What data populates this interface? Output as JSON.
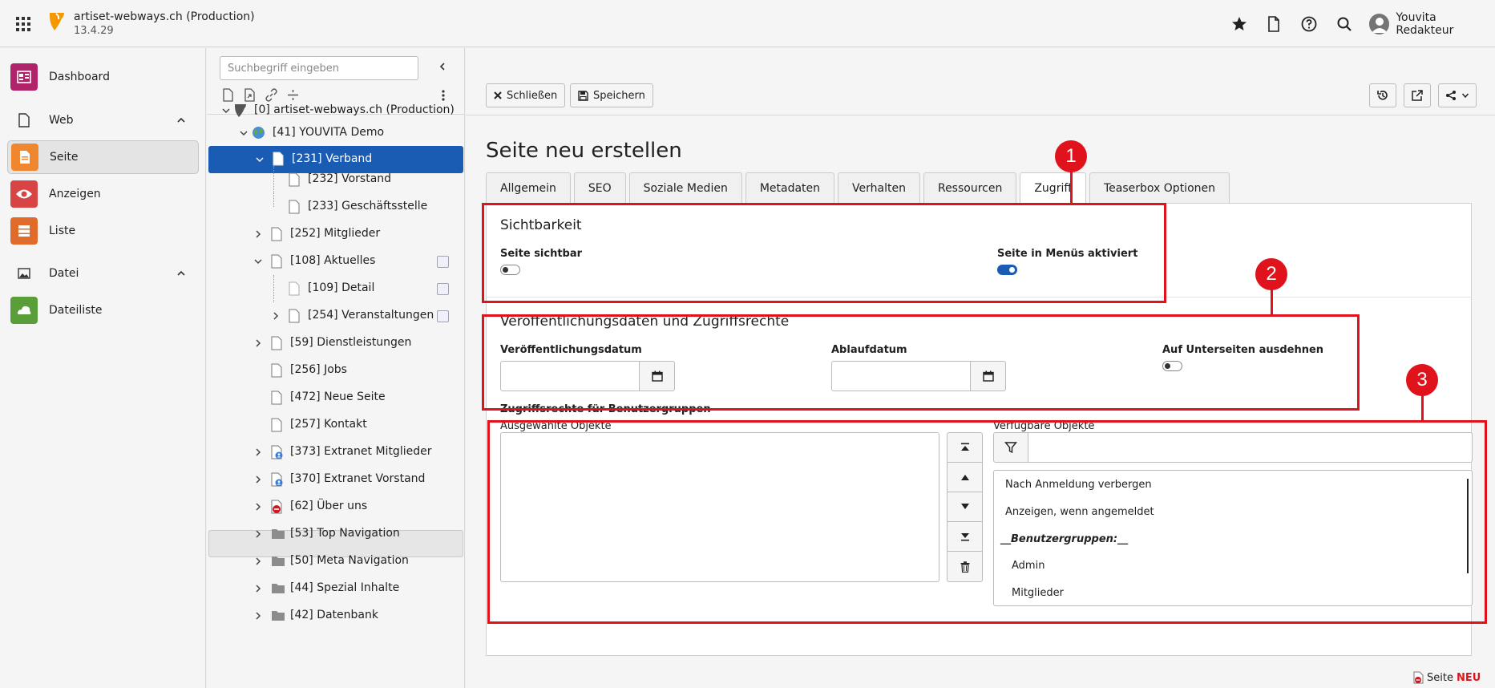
{
  "topbar": {
    "site_title": "artiset-webways.ch (Production)",
    "version": "13.4.29",
    "user_name": "Youvita Redakteur",
    "icons": [
      "bookmark-star-icon",
      "document-icon",
      "help-icon",
      "search-icon"
    ]
  },
  "modules": {
    "dashboard": "Dashboard",
    "web": "Web",
    "seite": "Seite",
    "anzeigen": "Anzeigen",
    "liste": "Liste",
    "datei": "Datei",
    "dateiliste": "Dateiliste"
  },
  "tree": {
    "search_placeholder": "Suchbegriff eingeben",
    "nodes": [
      {
        "label": "[0] artiset-webways.ch (Production)"
      },
      {
        "label": "[41] YOUVITA Demo"
      },
      {
        "label": "[231] Verband"
      },
      {
        "label": "[232] Vorstand"
      },
      {
        "label": "[233] Geschäftsstelle"
      },
      {
        "label": "[252] Mitglieder"
      },
      {
        "label": "[108] Aktuelles"
      },
      {
        "label": "[109] Detail"
      },
      {
        "label": "[254] Veranstaltungen"
      },
      {
        "label": "[59] Dienstleistungen"
      },
      {
        "label": "[256] Jobs"
      },
      {
        "label": "[472] Neue Seite"
      },
      {
        "label": "[257] Kontakt"
      },
      {
        "label": "[373] Extranet Mitglieder"
      },
      {
        "label": "[370] Extranet Vorstand"
      },
      {
        "label": "[62] Über uns"
      },
      {
        "label": "[53] Top Navigation"
      },
      {
        "label": "[50] Meta Navigation"
      },
      {
        "label": "[44] Spezial Inhalte"
      },
      {
        "label": "[42] Datenbank"
      }
    ]
  },
  "docbar": {
    "close_label": "Schließen",
    "save_label": "Speichern"
  },
  "page": {
    "heading": "Seite neu erstellen",
    "tabs": [
      "Allgemein",
      "SEO",
      "Soziale Medien",
      "Metadaten",
      "Verhalten",
      "Ressourcen",
      "Zugriff",
      "Teaserbox Optionen"
    ],
    "active_tab": "Zugriff"
  },
  "sections": {
    "visibility": {
      "title": "Sichtbarkeit",
      "page_visible_label": "Seite sichtbar",
      "page_visible": false,
      "in_menus_label": "Seite in Menüs aktiviert",
      "in_menus": true
    },
    "publishing": {
      "title": "Veröffentlichungsdaten und Zugriffsrechte",
      "publish_date_label": "Veröffentlichungsdatum",
      "publish_date_value": "",
      "expire_date_label": "Ablaufdatum",
      "expire_date_value": "",
      "extend_label": "Auf Unterseiten ausdehnen",
      "extend_to_subpages": false
    },
    "access": {
      "title": "Zugriffsrechte für Benutzergruppen",
      "selected_label": "Ausgewählte Objekte",
      "available_label": "Verfügbare Objekte",
      "filter_value": "",
      "available_items": [
        {
          "label": "Nach Anmeldung verbergen"
        },
        {
          "label": "Anzeigen, wenn angemeldet"
        },
        {
          "label": "__Benutzergruppen:__"
        },
        {
          "label": "Admin"
        },
        {
          "label": "Mitglieder"
        }
      ]
    }
  },
  "annotations": [
    "1",
    "2",
    "3"
  ],
  "footer": {
    "page_label": "Seite",
    "new_label": "NEU"
  },
  "colors": {
    "selected": "#1a5cb3",
    "annotation_red": "#e0121c"
  }
}
